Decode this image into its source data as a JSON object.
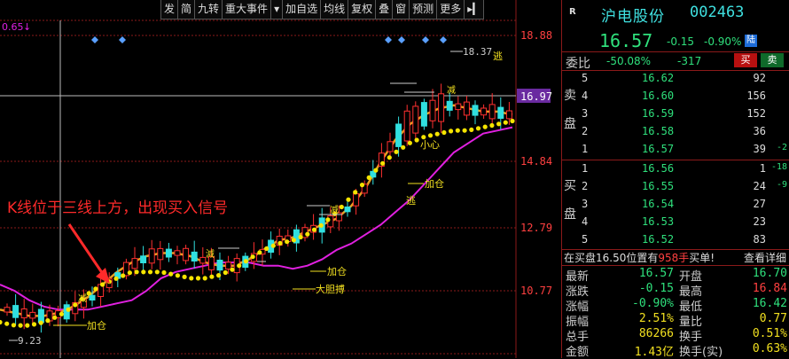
{
  "toolbar": [
    "发",
    "简",
    "九转",
    "重大事件",
    "▾",
    "加自选",
    "均线",
    "复权",
    "叠",
    "窗",
    "预测",
    "更多",
    "▸▎"
  ],
  "chart": {
    "indicator_value": "0.65",
    "price_axis": [
      "18.88",
      "16.97",
      "14.84",
      "12.79",
      "10.77"
    ],
    "crosshair_price": "16.97",
    "high_label": "18.37",
    "low_label": "9.23",
    "annotation_main": "K线位于三线上方，出现买入信号",
    "signals": [
      "逃",
      "小心",
      "加仓",
      "逃",
      "加仓",
      "大胆搏",
      "加仓",
      "减",
      "减",
      "减",
      "減"
    ],
    "colors": {
      "up": "#ff3030",
      "down": "#30e0e0",
      "ma_yellow": "#f5e400",
      "ma_orange": "#e8a020",
      "ma_magenta": "#e020e0"
    }
  },
  "chart_data": {
    "type": "line",
    "title": "",
    "xlabel": "",
    "ylabel": "",
    "ylim": [
      9.0,
      19.6
    ],
    "series": [
      {
        "name": "",
        "values": [
          11.2,
          11.0,
          10.7,
          10.5,
          10.4,
          10.4,
          10.4,
          10.5,
          10.6,
          10.7,
          11.0,
          11.4,
          11.6,
          11.7,
          11.8,
          11.9,
          11.9,
          11.9,
          11.8,
          11.8,
          11.7,
          11.8,
          12.0,
          12.3,
          12.5,
          12.8,
          13.1,
          13.5,
          13.9,
          14.4,
          14.9,
          15.4,
          15.7,
          16.0,
          16.1,
          16.2
        ]
      },
      {
        "name": "",
        "values": [
          10.4,
          10.3,
          10.2,
          10.2,
          10.3,
          10.5,
          10.8,
          11.2,
          11.6,
          11.9,
          12.1,
          12.2,
          12.2,
          12.1,
          11.9,
          11.8,
          11.8,
          12.0,
          12.3,
          12.6,
          12.7,
          12.9,
          13.1,
          13.3,
          13.7,
          14.3,
          15.1,
          15.8,
          16.3,
          16.6,
          16.8,
          16.9,
          16.8,
          16.7,
          16.7,
          16.6
        ]
      },
      {
        "name": "",
        "values": [
          10.0,
          9.9,
          9.9,
          10.0,
          10.2,
          10.5,
          10.9,
          11.2,
          11.4,
          11.6,
          11.6,
          11.6,
          11.5,
          11.4,
          11.4,
          11.5,
          11.7,
          12.0,
          12.3,
          12.5,
          12.6,
          12.8,
          13.1,
          13.5,
          14.0,
          14.5,
          15.0,
          15.4,
          15.7,
          15.9,
          16.0,
          16.1,
          16.1,
          16.2,
          16.3,
          16.4
        ]
      }
    ]
  },
  "quote": {
    "r_mark": "R",
    "name": "沪电股份",
    "code": "002463",
    "price": "16.57",
    "change": "-0.15",
    "change_pct": "-0.90%",
    "market_tag": "陆",
    "wb_label": "委比",
    "wb_pct": "-50.08%",
    "wb_diff": "-317",
    "buy_btn": "买",
    "sell_btn": "卖",
    "sell_side_label": [
      "卖",
      "盘"
    ],
    "buy_side_label": [
      "买",
      "盘"
    ],
    "asks": [
      {
        "lv": "5",
        "price": "16.62",
        "vol": "92",
        "delta": ""
      },
      {
        "lv": "4",
        "price": "16.60",
        "vol": "156",
        "delta": ""
      },
      {
        "lv": "3",
        "price": "16.59",
        "vol": "152",
        "delta": ""
      },
      {
        "lv": "2",
        "price": "16.58",
        "vol": "36",
        "delta": ""
      },
      {
        "lv": "1",
        "price": "16.57",
        "vol": "39",
        "delta": "-2"
      }
    ],
    "bids": [
      {
        "lv": "1",
        "price": "16.56",
        "vol": "1",
        "delta": "-18"
      },
      {
        "lv": "2",
        "price": "16.55",
        "vol": "24",
        "delta": "-9"
      },
      {
        "lv": "3",
        "price": "16.54",
        "vol": "27",
        "delta": ""
      },
      {
        "lv": "4",
        "price": "16.53",
        "vol": "23",
        "delta": ""
      },
      {
        "lv": "5",
        "price": "16.52",
        "vol": "83",
        "delta": ""
      }
    ],
    "note_a": "在买盘16.50位置有",
    "note_b": "958手",
    "note_c": "买单!",
    "note_link": "查看详细",
    "stats": [
      {
        "k1": "最新",
        "v1": "16.57",
        "c1": "g",
        "k2": "开盘",
        "v2": "16.70",
        "c2": "g"
      },
      {
        "k1": "涨跌",
        "v1": "-0.15",
        "c1": "g",
        "k2": "最高",
        "v2": "16.84",
        "c2": "r"
      },
      {
        "k1": "涨幅",
        "v1": "-0.90%",
        "c1": "g",
        "k2": "最低",
        "v2": "16.42",
        "c2": "g"
      },
      {
        "k1": "振幅",
        "v1": "2.51%",
        "c1": "y",
        "k2": "量比",
        "v2": "0.77",
        "c2": "y"
      },
      {
        "k1": "总手",
        "v1": "86266",
        "c1": "y",
        "k2": "换手",
        "v2": "0.51%",
        "c2": "y"
      },
      {
        "k1": "金额",
        "v1": "1.43亿",
        "c1": "y",
        "k2": "换手(实)",
        "v2": "0.63%",
        "c2": "y"
      }
    ]
  }
}
